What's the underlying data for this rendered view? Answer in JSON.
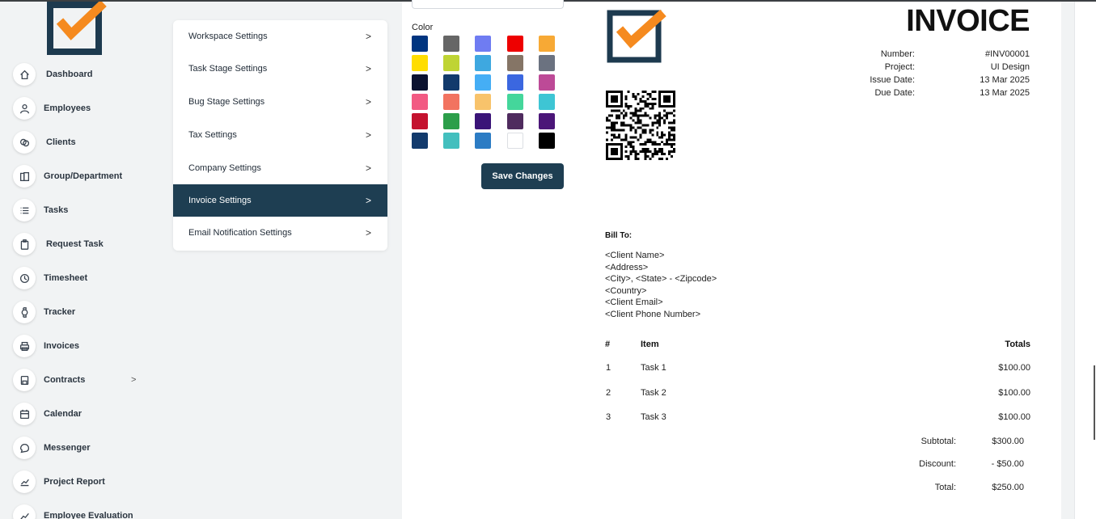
{
  "colors": {
    "accent_dark": "#1e3e52",
    "logo_orange": "#f58a1f",
    "logo_navy": "#1d3a4f"
  },
  "sidebar": {
    "items": [
      {
        "label": "Dashboard",
        "icon": "home-icon"
      },
      {
        "label": "Employees",
        "icon": "user-icon"
      },
      {
        "label": "Clients",
        "icon": "handshake-icon"
      },
      {
        "label": "Group/Department",
        "icon": "building-icon"
      },
      {
        "label": "Tasks",
        "icon": "list-icon"
      },
      {
        "label": "Request Task",
        "icon": "clipboard-icon"
      },
      {
        "label": "Timesheet",
        "icon": "clock-icon"
      },
      {
        "label": "Tracker",
        "icon": "watch-icon"
      },
      {
        "label": "Invoices",
        "icon": "printer-icon"
      },
      {
        "label": "Contracts",
        "icon": "save-icon",
        "chevron": ">"
      },
      {
        "label": "Calendar",
        "icon": "calendar-icon"
      },
      {
        "label": "Messenger",
        "icon": "chat-icon"
      },
      {
        "label": "Project Report",
        "icon": "chart-icon"
      },
      {
        "label": "Employee Evaluation",
        "icon": "trend-icon"
      }
    ]
  },
  "settings_menu": {
    "items": [
      {
        "label": "Workspace Settings",
        "chevron": ">"
      },
      {
        "label": "Task Stage Settings",
        "chevron": ">"
      },
      {
        "label": "Bug Stage Settings",
        "chevron": ">"
      },
      {
        "label": "Tax Settings",
        "chevron": ">"
      },
      {
        "label": "Company Settings",
        "chevron": ">"
      },
      {
        "label": "Invoice Settings",
        "chevron": ">",
        "active": true
      },
      {
        "label": "Email Notification Settings",
        "chevron": ">"
      }
    ]
  },
  "color_picker": {
    "label": "Color",
    "swatches": [
      "#003580",
      "#666666",
      "#6f7cf2",
      "#ee0000",
      "#f7a935",
      "#ffdd00",
      "#bfd434",
      "#3ea8e0",
      "#857566",
      "#6b7280",
      "#0b1230",
      "#123a6c",
      "#45aef5",
      "#3b67e0",
      "#bd4a97",
      "#f25a83",
      "#f27360",
      "#f8c36b",
      "#44d69b",
      "#3ec5d4",
      "#c4122f",
      "#2c9e4a",
      "#3a1478",
      "#4f2b5e",
      "#4b1678",
      "#123a6c",
      "#43bfbe",
      "#2c7cc4",
      "#ffffff",
      "#000000"
    ]
  },
  "save_button": "Save Changes",
  "invoice": {
    "title": "INVOICE",
    "meta": [
      {
        "key": "Number:",
        "value": "#INV00001"
      },
      {
        "key": "Project:",
        "value": "UI Design"
      },
      {
        "key": "Issue Date:",
        "value": "13 Mar 2025"
      },
      {
        "key": "Due Date:",
        "value": "13 Mar 2025"
      }
    ],
    "bill_to_label": "Bill To:",
    "address_lines": [
      "<Client Name>",
      "<Address>",
      "<City>, <State> - <Zipcode>",
      "<Country>",
      "<Client Email>",
      "<Client Phone Number>"
    ],
    "table": {
      "headers": {
        "num": "#",
        "item": "Item",
        "totals": "Totals"
      },
      "rows": [
        {
          "num": "1",
          "item": "Task 1",
          "total": "$100.00"
        },
        {
          "num": "2",
          "item": "Task 2",
          "total": "$100.00"
        },
        {
          "num": "3",
          "item": "Task 3",
          "total": "$100.00"
        }
      ]
    },
    "totals": [
      {
        "key": "Subtotal:",
        "value": "$300.00"
      },
      {
        "key": "Discount:",
        "value": "- $50.00"
      },
      {
        "key": "Total:",
        "value": "$250.00"
      }
    ]
  }
}
